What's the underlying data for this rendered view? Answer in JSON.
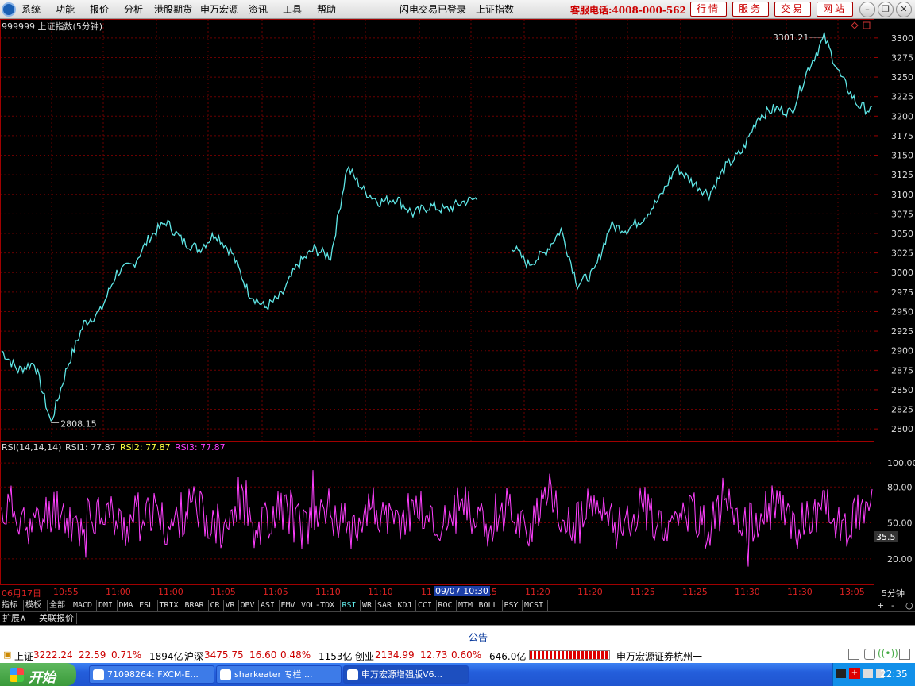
{
  "menu": {
    "items": [
      "系统",
      "功能",
      "报价",
      "分析",
      "港股期货",
      "申万宏源",
      "资讯",
      "工具",
      "帮助"
    ],
    "login_status": "闪电交易已登录",
    "index_name": "上证指数",
    "hotline": "客服电话:4008-000-562",
    "service_buttons": [
      "行情",
      "服务",
      "交易",
      "网站"
    ]
  },
  "chart_title": "999999 上证指数(5分钟)",
  "chart_data": [
    {
      "type": "line",
      "title": "999999 上证指数(5分钟)",
      "ylim": [
        2790,
        3310
      ],
      "yticks": [
        2800,
        2825,
        2850,
        2875,
        2900,
        2925,
        2950,
        2975,
        3000,
        3025,
        3050,
        3075,
        3100,
        3125,
        3150,
        3175,
        3200,
        3225,
        3250,
        3275,
        3300
      ],
      "x": [
        0,
        0.02,
        0.04,
        0.06,
        0.08,
        0.1,
        0.12,
        0.14,
        0.16,
        0.18,
        0.2,
        0.22,
        0.24,
        0.26,
        0.28,
        0.3,
        0.32,
        0.34,
        0.36,
        0.38,
        0.4,
        0.42,
        0.44,
        0.46,
        0.48,
        0.5,
        0.52,
        0.54,
        0.56,
        0.58,
        0.6,
        0.62,
        0.64,
        0.66,
        0.68,
        0.7,
        0.72,
        0.74,
        0.76,
        0.78,
        0.8,
        0.82,
        0.84,
        0.86,
        0.88,
        0.9,
        0.92,
        0.94,
        0.96,
        0.98,
        1
      ],
      "values": [
        2900,
        2875,
        2885,
        2808,
        2880,
        2935,
        2950,
        3000,
        3010,
        3045,
        3065,
        3040,
        3030,
        3050,
        3025,
        2975,
        2955,
        2970,
        3010,
        3030,
        3020,
        3135,
        3105,
        3090,
        3095,
        3075,
        3085,
        3080,
        3090,
        3095,
        null,
        3035,
        3010,
        3025,
        3055,
        2985,
        3000,
        3060,
        3055,
        3070,
        3095,
        3135,
        3115,
        3100,
        3135,
        3155,
        3200,
        3210,
        3205,
        3260,
        3301,
        3250,
        3215,
        3205
      ],
      "annotations": [
        {
          "text": "3301.21"
        },
        {
          "text": "2808.15"
        }
      ]
    },
    {
      "type": "line",
      "title": "RSI(14,14,14)",
      "legend": [
        "RSI1: 77.87",
        "RSI2: 77.87",
        "RSI3: 77.87"
      ],
      "ylim": [
        0,
        110
      ],
      "yticks": [
        20,
        50,
        80,
        100
      ],
      "current_label": "35.5"
    }
  ],
  "rsi_legend": {
    "title": "RSI(14,14,14)",
    "rsi1": "RSI1: 77.87",
    "rsi2": "RSI2: 77.87",
    "rsi3": "RSI3: 77.87"
  },
  "time_axis": {
    "date": "06月17日",
    "labels": [
      "10:55",
      "11:00",
      "11:00",
      "11:05",
      "11:05",
      "11:10",
      "11:10",
      "11",
      "15",
      "11:20",
      "11:20",
      "11:25",
      "11:25",
      "11:30",
      "11:30",
      "13:05"
    ],
    "cursor": "09/07 10:30",
    "period": "5分钟"
  },
  "indicator_tabs": [
    "指标",
    "模板",
    "全部",
    "MACD",
    "DMI",
    "DMA",
    "FSL",
    "TRIX",
    "BRAR",
    "CR",
    "VR",
    "OBV",
    "ASI",
    "EMV",
    "VOL-TDX",
    "RSI",
    "WR",
    "SAR",
    "KDJ",
    "CCI",
    "ROC",
    "MTM",
    "BOLL",
    "PSY",
    "MCST"
  ],
  "active_tab": "RSI",
  "ext_tabs": [
    "扩展∧",
    "关联报价"
  ],
  "notice": "公告",
  "quotes": {
    "sh_name": "上证",
    "sh_price": "3222.24",
    "sh_chg": "22.59",
    "sh_pct": "0.71%",
    "sh_vol": "1894亿",
    "hs_name": "沪深",
    "hs_price": "3475.75",
    "hs_chg": "16.60",
    "hs_pct": "0.48%",
    "hs_vol": "1153亿",
    "cy_name": "创业",
    "cy_price": "2134.99",
    "cy_chg": "12.73",
    "cy_pct": "0.60%",
    "cy_vol": "646.0亿",
    "broker": "申万宏源证券杭州一"
  },
  "taskbar": {
    "start": "开始",
    "tasks": [
      "71098264: FXCM-E...",
      "sharkeater 专栏 ...",
      "申万宏源增强版V6..."
    ],
    "clock": "22:35"
  }
}
